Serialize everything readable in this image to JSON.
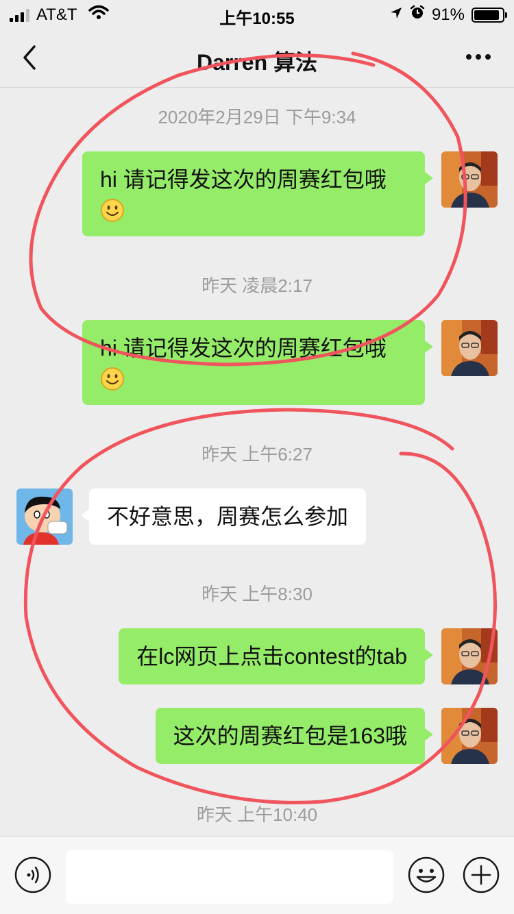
{
  "status": {
    "carrier": "AT&T",
    "time": "上午10:55",
    "battery": "91%",
    "battery_level": 0.91
  },
  "nav": {
    "title": "Darren 算法"
  },
  "timestamps": {
    "t1": "2020年2月29日 下午9:34",
    "t2": "昨天 凌晨2:17",
    "t3": "昨天 上午6:27",
    "t4": "昨天 上午8:30",
    "t5": "昨天 上午10:40"
  },
  "messages": {
    "m1": "hi 请记得发这次的周赛红包哦",
    "m2": "hi 请记得发这次的周赛红包哦",
    "m3": "不好意思，周赛怎么参加",
    "m4": "在lc网页上点击contest的tab",
    "m5": "这次的周赛红包是163哦"
  },
  "icons": {
    "back": "chevron-left-icon",
    "more": "more-dots-icon",
    "voice": "voice-icon",
    "emoji": "emoji-icon",
    "add": "plus-icon",
    "smiley": "smiley-emoji-icon"
  },
  "colors": {
    "sent_bubble": "#95ec69",
    "received_bubble": "#ffffff",
    "background": "#ededed",
    "annotation_stroke": "#f0545c"
  }
}
